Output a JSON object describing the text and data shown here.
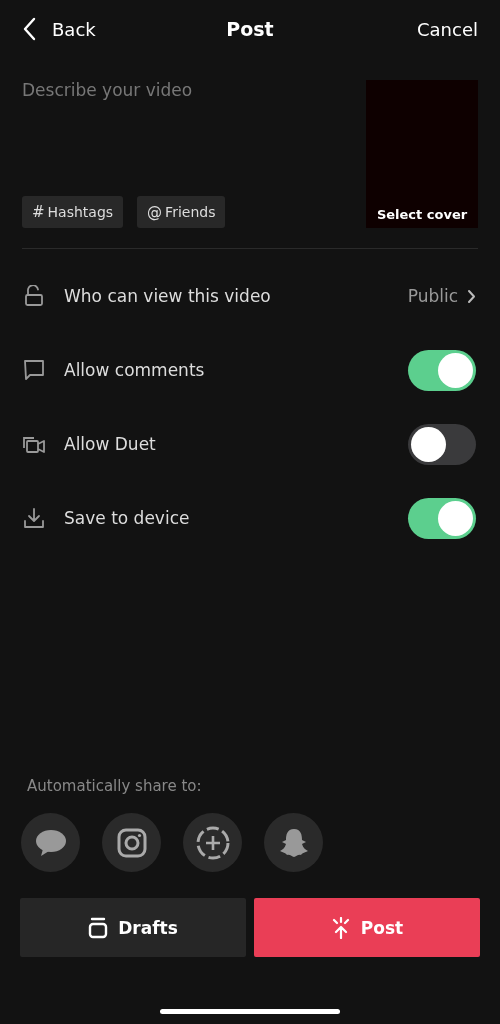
{
  "header": {
    "back": "Back",
    "title": "Post",
    "cancel": "Cancel"
  },
  "description": {
    "placeholder": "Describe your video"
  },
  "tags": [
    {
      "symbol": "#",
      "label": "Hashtags"
    },
    {
      "symbol": "@",
      "label": "Friends"
    }
  ],
  "cover": {
    "label": "Select cover"
  },
  "settings": [
    {
      "kind": "link",
      "label": "Who can view this video",
      "value": "Public"
    },
    {
      "kind": "toggle",
      "label": "Allow comments",
      "on": true
    },
    {
      "kind": "toggle",
      "label": "Allow Duet",
      "on": false
    },
    {
      "kind": "toggle",
      "label": "Save to device",
      "on": true
    }
  ],
  "share": {
    "label": "Automatically share to:"
  },
  "buttons": {
    "drafts": "Drafts",
    "post": "Post"
  }
}
